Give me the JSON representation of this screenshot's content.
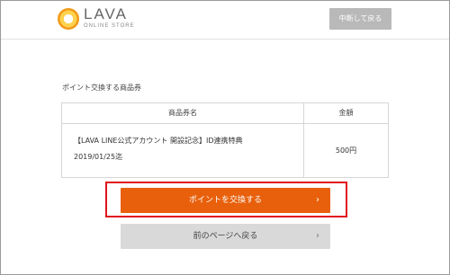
{
  "header": {
    "logo_text": "LAVA",
    "logo_subtext": "ONLINE STORE",
    "quit_label": "中断して戻る"
  },
  "main": {
    "section_title": "ポイント交換する商品券",
    "table": {
      "headers": [
        "商品券名",
        "金額"
      ],
      "rows": [
        {
          "name_line1": "【LAVA LINE公式アカウント 開設記念】ID連携特典",
          "name_line2": "2019/01/25迄",
          "price": "500円"
        }
      ]
    },
    "exchange_label": "ポイントを交換する",
    "back_label": "前のページへ戻る",
    "chevron": "›"
  },
  "colors": {
    "accent": "#e8600c",
    "highlight": "#e0141e",
    "quit_bg": "#b9b9b9",
    "back_bg": "#d9d9d9"
  }
}
